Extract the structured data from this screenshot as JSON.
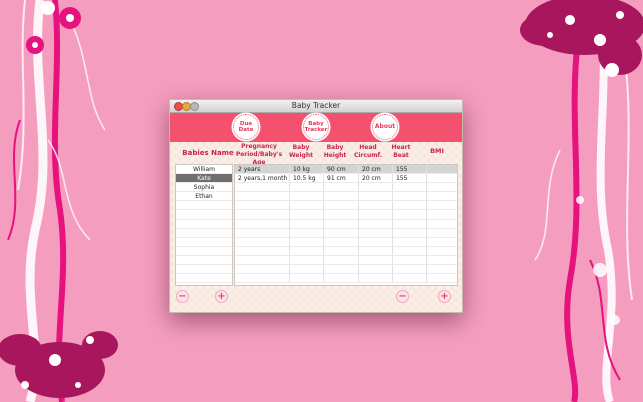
{
  "window": {
    "title": "Baby Tracker"
  },
  "toolbar": {
    "due_date": "Due Date",
    "baby_tracker": "Baby Tracker",
    "about": "About"
  },
  "babies": {
    "header": "Babies Name",
    "names": [
      "William",
      "Kate",
      "Sophia",
      "Ethan"
    ],
    "selected_index": 1
  },
  "table": {
    "headers": {
      "pregnancy": "Pregnancy Period/Baby's Age",
      "weight": "Baby Weight",
      "height": "Baby Height",
      "head": "Head Circumf.",
      "heart": "Heart Beat",
      "bmi": "BMI"
    },
    "rows": [
      {
        "pregnancy": "2 years",
        "weight": "10 kg",
        "height": "90 cm",
        "head": "20 cm",
        "heart": "155",
        "bmi": ""
      },
      {
        "pregnancy": "2 years,1 month",
        "weight": "10.5 kg",
        "height": "91 cm",
        "head": "20 cm",
        "heart": "155",
        "bmi": ""
      }
    ]
  },
  "buttons": {
    "remove_baby": "−",
    "add_baby": "+",
    "remove_record": "−",
    "add_record": "+"
  },
  "colors": {
    "background": "#f59dbf",
    "toolbar": "#f4516f",
    "accent_text": "#c62456",
    "flower_dark": "#a8175e",
    "flower_pink": "#e5127f"
  }
}
